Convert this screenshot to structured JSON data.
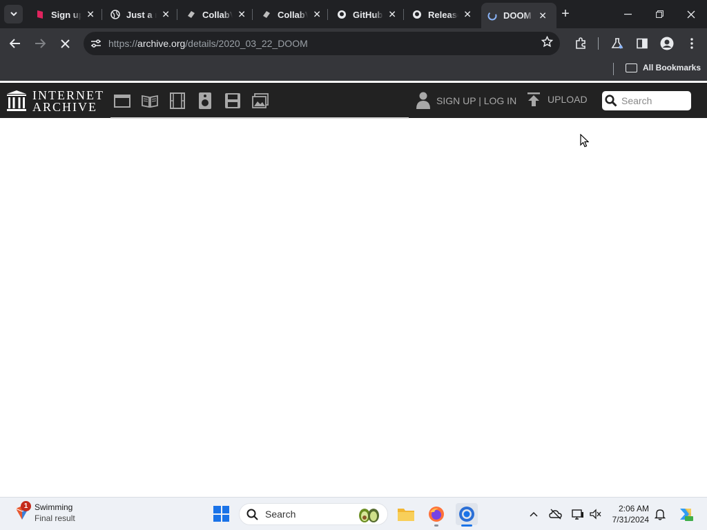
{
  "browser": {
    "tabs": [
      {
        "title": "Sign up",
        "icon": "signup-favicon",
        "active": false
      },
      {
        "title": "Just a moment",
        "icon": "globe-favicon",
        "active": false
      },
      {
        "title": "CollabVM",
        "icon": "collabvm-favicon",
        "active": false
      },
      {
        "title": "CollabVM",
        "icon": "collabvm-favicon",
        "active": false
      },
      {
        "title": "GitHub",
        "icon": "github-favicon",
        "active": false
      },
      {
        "title": "Releases",
        "icon": "github-favicon",
        "active": false
      },
      {
        "title": "DOOM",
        "icon": "archive-favicon",
        "active": true
      }
    ],
    "url_prefix": "https://",
    "url_host": "archive.org",
    "url_path": "/details/2020_03_22_DOOM",
    "all_bookmarks_label": "All Bookmarks"
  },
  "site": {
    "logo_line1": "INTERNET",
    "logo_line2": "ARCHIVE",
    "media_icons": [
      "web-icon",
      "texts-icon",
      "video-icon",
      "audio-icon",
      "software-icon",
      "images-icon"
    ],
    "signup_login_label": "SIGN UP | LOG IN",
    "upload_label": "UPLOAD",
    "search_placeholder": "Search"
  },
  "taskbar": {
    "weather_badge": "1",
    "weather_title": "Swimming",
    "weather_sub": "Final result",
    "search_label": "Search",
    "time": "2:06 AM",
    "date": "7/31/2024",
    "accent": "#1a73e8"
  }
}
